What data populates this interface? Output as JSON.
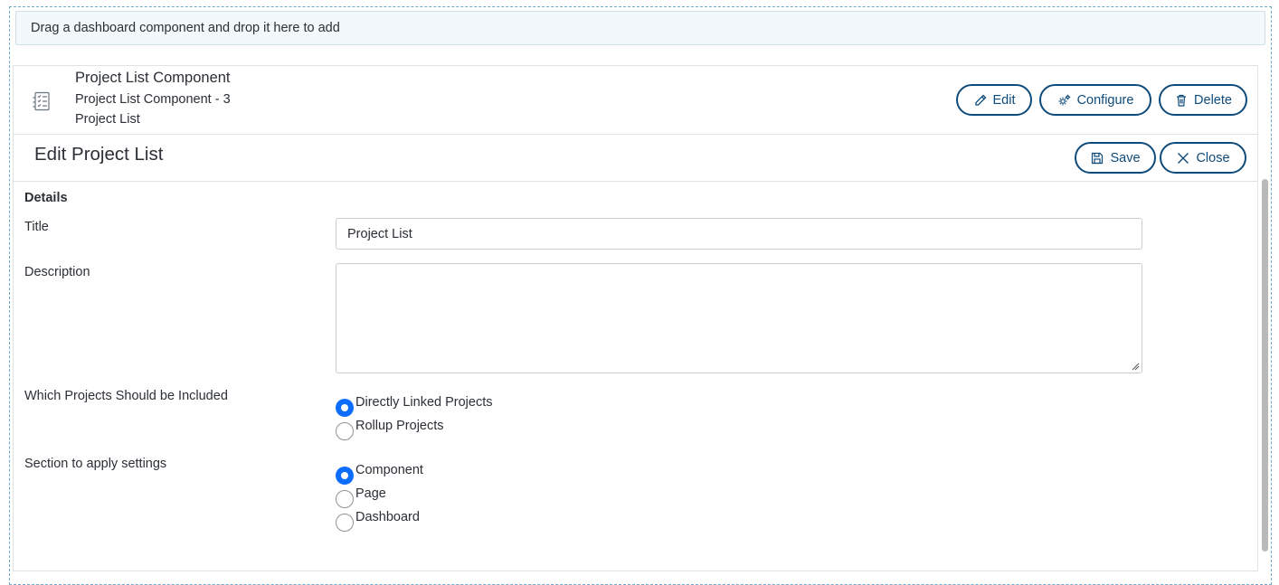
{
  "drop_zone": {
    "text": "Drag a dashboard component and drop it here to add"
  },
  "component": {
    "title": "Project List Component",
    "subtitle": "Project List Component - 3",
    "type": "Project List",
    "icon": "checklist-icon",
    "actions": {
      "edit": "Edit",
      "configure": "Configure",
      "delete": "Delete"
    }
  },
  "editor": {
    "title": "Edit Project List",
    "save": "Save",
    "close": "Close",
    "section": "Details",
    "fields": {
      "title_label": "Title",
      "title_value": "Project List",
      "description_label": "Description",
      "description_value": "",
      "projects_label": "Which Projects Should be Included",
      "projects_options": [
        "Directly Linked Projects",
        "Rollup Projects"
      ],
      "projects_selected": "Directly Linked Projects",
      "section_label": "Section to apply settings",
      "section_options": [
        "Component",
        "Page",
        "Dashboard"
      ],
      "section_selected": "Component"
    }
  },
  "colors": {
    "accent": "#0f4b7a",
    "radio_checked": "#0d6efd",
    "drop_zone_bg": "#f2f8fb"
  }
}
